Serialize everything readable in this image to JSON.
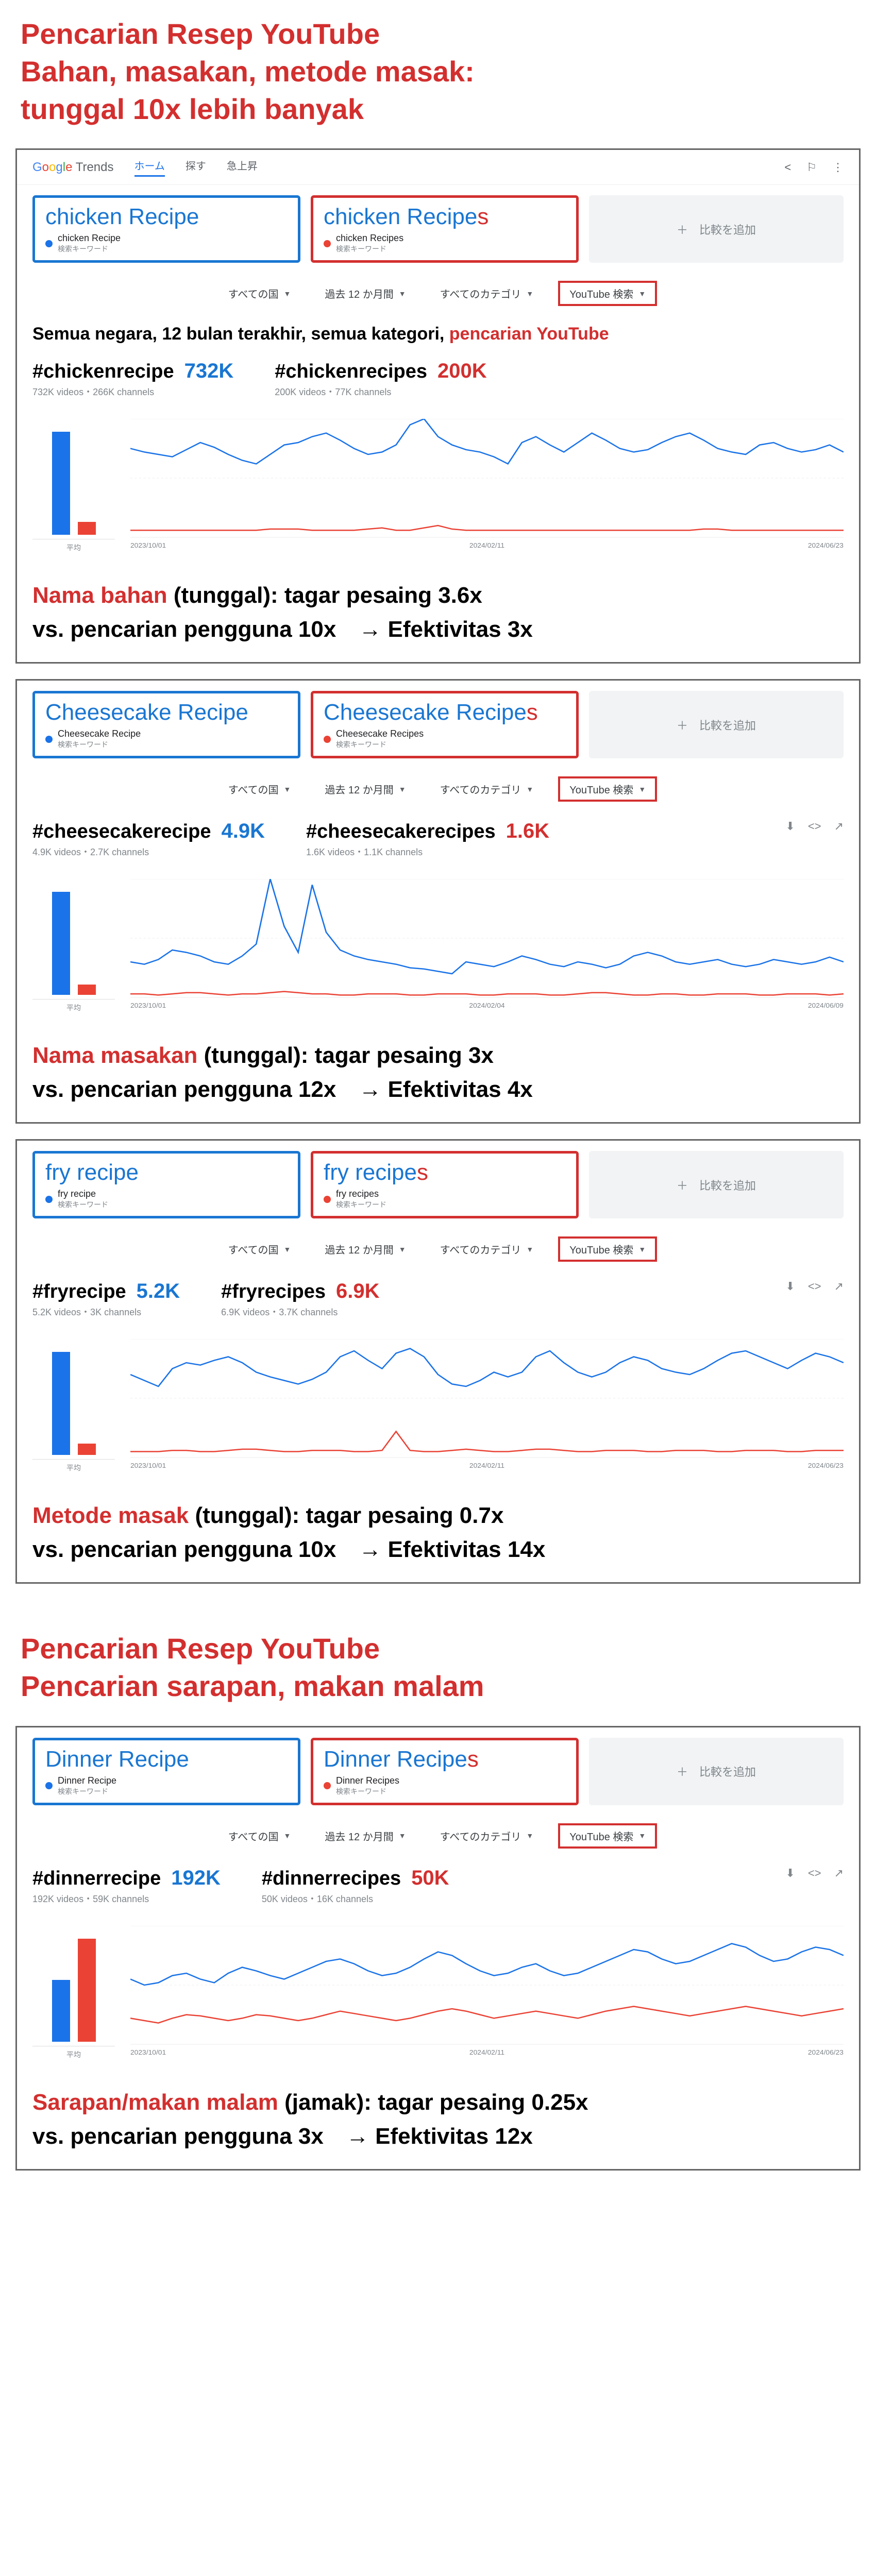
{
  "titles": {
    "main1_l1": "Pencarian Resep YouTube",
    "main1_l2": "Bahan, masakan, metode masak:",
    "main1_l3": " tunggal 10x lebih banyak",
    "main2_l1": "Pencarian Resep YouTube",
    "main2_l2": "Pencarian sarapan, makan malam"
  },
  "trends_header": {
    "nav_home": "ホーム",
    "nav_explore": "探す",
    "nav_rising": "急上昇",
    "add_compare": "＋　比較を追加"
  },
  "filters": {
    "country": "すべての国",
    "period": "過去 12 か月間",
    "category": "すべてのカテゴリ",
    "search_type": "YouTube 検索"
  },
  "filter_summary": {
    "text1": "Semua negara, 12 bulan terakhir, semua kategori, ",
    "text2": "pencarian YouTube"
  },
  "term_sub_label": "検索キーワード",
  "bar_avg_label": "平均",
  "panels": [
    {
      "term1": "chicken Recipe",
      "term1_full": "chicken Recipe",
      "term2_base": "chicken Recipe",
      "term2_s": "s",
      "term2_full": "chicken Recipes",
      "hash1": "#chickenrecipe",
      "count1": "732K",
      "sub1": "732K videos・266K channels",
      "hash2": "#chickenrecipes",
      "count2": "200K",
      "sub2": "200K videos・77K channels",
      "concl_red": "Nama bahan",
      "concl_1": " (tunggal): tagar pesaing 3.6x",
      "concl_2": "vs. pencarian pengguna 10x　→ Efektivitas 3x",
      "bars": {
        "blue_h": 200,
        "red_h": 25
      },
      "show_full_header": true,
      "show_filter_summary": true,
      "show_actions": false,
      "x_labels": [
        "2023/10/01",
        "2024/02/11",
        "2024/06/23"
      ],
      "line_blue": [
        75,
        72,
        70,
        68,
        74,
        80,
        76,
        70,
        65,
        62,
        70,
        78,
        80,
        85,
        88,
        82,
        75,
        70,
        72,
        78,
        95,
        100,
        85,
        78,
        74,
        72,
        68,
        62,
        80,
        85,
        78,
        72,
        80,
        88,
        82,
        75,
        72,
        74,
        80,
        85,
        88,
        82,
        75,
        72,
        70,
        78,
        80,
        75,
        72,
        74,
        78,
        72
      ],
      "line_red": [
        6,
        6,
        6,
        6,
        6,
        6,
        6,
        6,
        6,
        6,
        7,
        7,
        7,
        6,
        6,
        6,
        6,
        7,
        8,
        6,
        6,
        8,
        10,
        7,
        6,
        6,
        6,
        6,
        6,
        6,
        6,
        6,
        6,
        6,
        6,
        6,
        6,
        6,
        6,
        6,
        6,
        7,
        7,
        6,
        6,
        6,
        6,
        6,
        6,
        6,
        6,
        6
      ]
    },
    {
      "term1": "Cheesecake Recipe",
      "term1_full": "Cheesecake Recipe",
      "term2_base": "Cheesecake Recipe",
      "term2_s": "s",
      "term2_full": "Cheesecake Recipes",
      "hash1": "#cheesecakerecipe",
      "count1": "4.9K",
      "sub1": "4.9K videos・2.7K channels",
      "hash2": "#cheesecakerecipes",
      "count2": "1.6K",
      "sub2": "1.6K videos・1.1K channels",
      "concl_red": "Nama masakan",
      "concl_1": " (tunggal): tagar pesaing 3x",
      "concl_2": "vs. pencarian pengguna 12x　→ Efektivitas 4x",
      "bars": {
        "blue_h": 200,
        "red_h": 20
      },
      "show_full_header": false,
      "show_filter_summary": false,
      "show_actions": true,
      "x_labels": [
        "2023/10/01",
        "2024/02/04",
        "2024/06/09"
      ],
      "line_blue": [
        30,
        28,
        32,
        40,
        38,
        35,
        30,
        28,
        35,
        45,
        100,
        60,
        38,
        95,
        55,
        40,
        35,
        32,
        30,
        28,
        25,
        24,
        22,
        20,
        30,
        28,
        26,
        30,
        35,
        32,
        28,
        26,
        30,
        28,
        25,
        28,
        35,
        38,
        35,
        30,
        28,
        30,
        32,
        28,
        26,
        28,
        32,
        30,
        28,
        30,
        34,
        30
      ],
      "line_red": [
        3,
        3,
        2,
        3,
        4,
        4,
        3,
        2,
        3,
        3,
        4,
        5,
        4,
        3,
        3,
        2,
        2,
        3,
        3,
        3,
        2,
        2,
        3,
        3,
        3,
        2,
        2,
        3,
        3,
        3,
        2,
        2,
        3,
        4,
        4,
        3,
        2,
        2,
        3,
        3,
        2,
        2,
        3,
        3,
        3,
        2,
        2,
        3,
        3,
        3,
        2,
        3
      ]
    },
    {
      "term1": "fry recipe",
      "term1_full": "fry recipe",
      "term2_base": "fry recipe",
      "term2_s": "s",
      "term2_full": "fry recipes",
      "hash1": "#fryrecipe",
      "count1": "5.2K",
      "sub1": "5.2K videos・3K channels",
      "hash2": "#fryrecipes",
      "count2": "6.9K",
      "sub2": "6.9K videos・3.7K channels",
      "concl_red": "Metode masak",
      "concl_1": " (tunggal): tagar pesaing 0.7x",
      "concl_2": "vs. pencarian pengguna 10x　→ Efektivitas 14x",
      "bars": {
        "blue_h": 200,
        "red_h": 22
      },
      "show_full_header": false,
      "show_filter_summary": false,
      "show_actions": true,
      "x_labels": [
        "2023/10/01",
        "2024/02/11",
        "2024/06/23"
      ],
      "line_blue": [
        70,
        65,
        60,
        75,
        80,
        78,
        82,
        85,
        80,
        72,
        68,
        65,
        62,
        66,
        72,
        85,
        90,
        82,
        75,
        88,
        92,
        85,
        70,
        62,
        60,
        65,
        72,
        68,
        72,
        85,
        90,
        80,
        72,
        68,
        72,
        80,
        85,
        82,
        75,
        72,
        70,
        75,
        82,
        88,
        90,
        85,
        80,
        75,
        82,
        88,
        85,
        80
      ],
      "line_red": [
        5,
        5,
        5,
        6,
        6,
        5,
        5,
        6,
        7,
        7,
        6,
        5,
        5,
        6,
        6,
        6,
        5,
        5,
        6,
        22,
        6,
        5,
        5,
        6,
        7,
        6,
        5,
        5,
        6,
        7,
        7,
        6,
        5,
        5,
        6,
        6,
        6,
        5,
        5,
        6,
        6,
        6,
        5,
        5,
        6,
        6,
        6,
        5,
        5,
        6,
        6,
        6
      ]
    },
    {
      "term1": "Dinner Recipe",
      "term1_full": "Dinner Recipe",
      "term2_base": "Dinner Recipe",
      "term2_s": "s",
      "term2_full": "Dinner Recipes",
      "hash1": "#dinnerrecipe",
      "count1": "192K",
      "sub1": "192K videos・59K channels",
      "hash2": "#dinnerrecipes",
      "count2": "50K",
      "sub2": "50K videos・16K channels",
      "concl_red": "Sarapan/makan malam",
      "concl_1": " (jamak): tagar pesaing 0.25x",
      "concl_2": "vs. pencarian pengguna 3x　→ Efektivitas 12x",
      "bars": {
        "blue_h": 120,
        "red_h": 200
      },
      "show_full_header": false,
      "show_filter_summary": false,
      "show_actions": true,
      "x_labels": [
        "2023/10/01",
        "2024/02/11",
        "2024/06/23"
      ],
      "line_blue": [
        55,
        50,
        52,
        58,
        60,
        55,
        52,
        60,
        65,
        62,
        58,
        55,
        60,
        65,
        70,
        72,
        68,
        62,
        58,
        60,
        65,
        72,
        78,
        75,
        68,
        62,
        58,
        60,
        65,
        68,
        62,
        58,
        60,
        65,
        70,
        75,
        80,
        78,
        72,
        68,
        70,
        75,
        80,
        85,
        82,
        75,
        70,
        72,
        78,
        82,
        80,
        75
      ],
      "line_red": [
        22,
        20,
        18,
        22,
        25,
        24,
        22,
        20,
        22,
        25,
        24,
        22,
        20,
        22,
        25,
        28,
        26,
        24,
        22,
        20,
        22,
        25,
        28,
        30,
        28,
        25,
        22,
        24,
        26,
        28,
        26,
        24,
        22,
        25,
        28,
        30,
        32,
        30,
        28,
        26,
        24,
        26,
        28,
        30,
        32,
        30,
        28,
        26,
        24,
        26,
        28,
        30
      ]
    }
  ],
  "chart_data": [
    {
      "type": "line",
      "title": "chicken Recipe vs chicken Recipes — YouTube search interest, past 12 months",
      "xlabel": "",
      "ylabel": "",
      "ylim": [
        0,
        100
      ],
      "series": [
        {
          "name": "chicken Recipe",
          "values": [
            75,
            72,
            70,
            68,
            74,
            80,
            76,
            70,
            65,
            62,
            70,
            78,
            80,
            85,
            88,
            82,
            75,
            70,
            72,
            78,
            95,
            100,
            85,
            78,
            74,
            72,
            68,
            62,
            80,
            85,
            78,
            72,
            80,
            88,
            82,
            75,
            72,
            74,
            80,
            85,
            88,
            82,
            75,
            72,
            70,
            78,
            80,
            75,
            72,
            74,
            78,
            72
          ]
        },
        {
          "name": "chicken Recipes",
          "values": [
            6,
            6,
            6,
            6,
            6,
            6,
            6,
            6,
            6,
            6,
            7,
            7,
            7,
            6,
            6,
            6,
            6,
            7,
            8,
            6,
            6,
            8,
            10,
            7,
            6,
            6,
            6,
            6,
            6,
            6,
            6,
            6,
            6,
            6,
            6,
            6,
            6,
            6,
            6,
            6,
            6,
            7,
            7,
            6,
            6,
            6,
            6,
            6,
            6,
            6,
            6,
            6
          ]
        }
      ],
      "avg_bar": {
        "type": "bar",
        "categories": [
          "chicken Recipe",
          "chicken Recipes"
        ],
        "values": [
          78,
          7
        ]
      }
    },
    {
      "type": "line",
      "title": "Cheesecake Recipe vs Cheesecake Recipes — YouTube search interest, past 12 months",
      "xlabel": "",
      "ylabel": "",
      "ylim": [
        0,
        100
      ],
      "series": [
        {
          "name": "Cheesecake Recipe",
          "values": [
            30,
            28,
            32,
            40,
            38,
            35,
            30,
            28,
            35,
            45,
            100,
            60,
            38,
            95,
            55,
            40,
            35,
            32,
            30,
            28,
            25,
            24,
            22,
            20,
            30,
            28,
            26,
            30,
            35,
            32,
            28,
            26,
            30,
            28,
            25,
            28,
            35,
            38,
            35,
            30,
            28,
            30,
            32,
            28,
            26,
            28,
            32,
            30,
            28,
            30,
            34,
            30
          ]
        },
        {
          "name": "Cheesecake Recipes",
          "values": [
            3,
            3,
            2,
            3,
            4,
            4,
            3,
            2,
            3,
            3,
            4,
            5,
            4,
            3,
            3,
            2,
            2,
            3,
            3,
            3,
            2,
            2,
            3,
            3,
            3,
            2,
            2,
            3,
            3,
            3,
            2,
            2,
            3,
            4,
            4,
            3,
            2,
            2,
            3,
            3,
            2,
            2,
            3,
            3,
            3,
            2,
            2,
            3,
            3,
            3,
            2,
            3
          ]
        }
      ],
      "avg_bar": {
        "type": "bar",
        "categories": [
          "Cheesecake Recipe",
          "Cheesecake Recipes"
        ],
        "values": [
          33,
          3
        ]
      }
    },
    {
      "type": "line",
      "title": "fry recipe vs fry recipes — YouTube search interest, past 12 months",
      "xlabel": "",
      "ylabel": "",
      "ylim": [
        0,
        100
      ],
      "series": [
        {
          "name": "fry recipe",
          "values": [
            70,
            65,
            60,
            75,
            80,
            78,
            82,
            85,
            80,
            72,
            68,
            65,
            62,
            66,
            72,
            85,
            90,
            82,
            75,
            88,
            92,
            85,
            70,
            62,
            60,
            65,
            72,
            68,
            72,
            85,
            90,
            80,
            72,
            68,
            72,
            80,
            85,
            82,
            75,
            72,
            70,
            75,
            82,
            88,
            90,
            85,
            80,
            75,
            82,
            88,
            85,
            80
          ]
        },
        {
          "name": "fry recipes",
          "values": [
            5,
            5,
            5,
            6,
            6,
            5,
            5,
            6,
            7,
            7,
            6,
            5,
            5,
            6,
            6,
            6,
            5,
            5,
            6,
            22,
            6,
            5,
            5,
            6,
            7,
            6,
            5,
            5,
            6,
            7,
            7,
            6,
            5,
            5,
            6,
            6,
            6,
            5,
            5,
            6,
            6,
            6,
            5,
            5,
            6,
            6,
            6,
            5,
            5,
            6,
            6,
            6
          ]
        }
      ],
      "avg_bar": {
        "type": "bar",
        "categories": [
          "fry recipe",
          "fry recipes"
        ],
        "values": [
          78,
          7
        ]
      }
    },
    {
      "type": "line",
      "title": "Dinner Recipe vs Dinner Recipes — YouTube search interest, past 12 months",
      "xlabel": "",
      "ylabel": "",
      "ylim": [
        0,
        100
      ],
      "series": [
        {
          "name": "Dinner Recipe",
          "values": [
            55,
            50,
            52,
            58,
            60,
            55,
            52,
            60,
            65,
            62,
            58,
            55,
            60,
            65,
            70,
            72,
            68,
            62,
            58,
            60,
            65,
            72,
            78,
            75,
            68,
            62,
            58,
            60,
            65,
            68,
            62,
            58,
            60,
            65,
            70,
            75,
            80,
            78,
            72,
            68,
            70,
            75,
            80,
            85,
            82,
            75,
            70,
            72,
            78,
            82,
            80,
            75
          ]
        },
        {
          "name": "Dinner Recipes",
          "values": [
            22,
            20,
            18,
            22,
            25,
            24,
            22,
            20,
            22,
            25,
            24,
            22,
            20,
            22,
            25,
            28,
            26,
            24,
            22,
            20,
            22,
            25,
            28,
            30,
            28,
            25,
            22,
            24,
            26,
            28,
            26,
            24,
            22,
            25,
            28,
            30,
            32,
            30,
            28,
            26,
            24,
            26,
            28,
            30,
            32,
            30,
            28,
            26,
            24,
            26,
            28,
            30
          ]
        }
      ],
      "avg_bar": {
        "type": "bar",
        "categories": [
          "Dinner Recipe",
          "Dinner Recipes"
        ],
        "values": [
          45,
          80
        ]
      }
    }
  ]
}
